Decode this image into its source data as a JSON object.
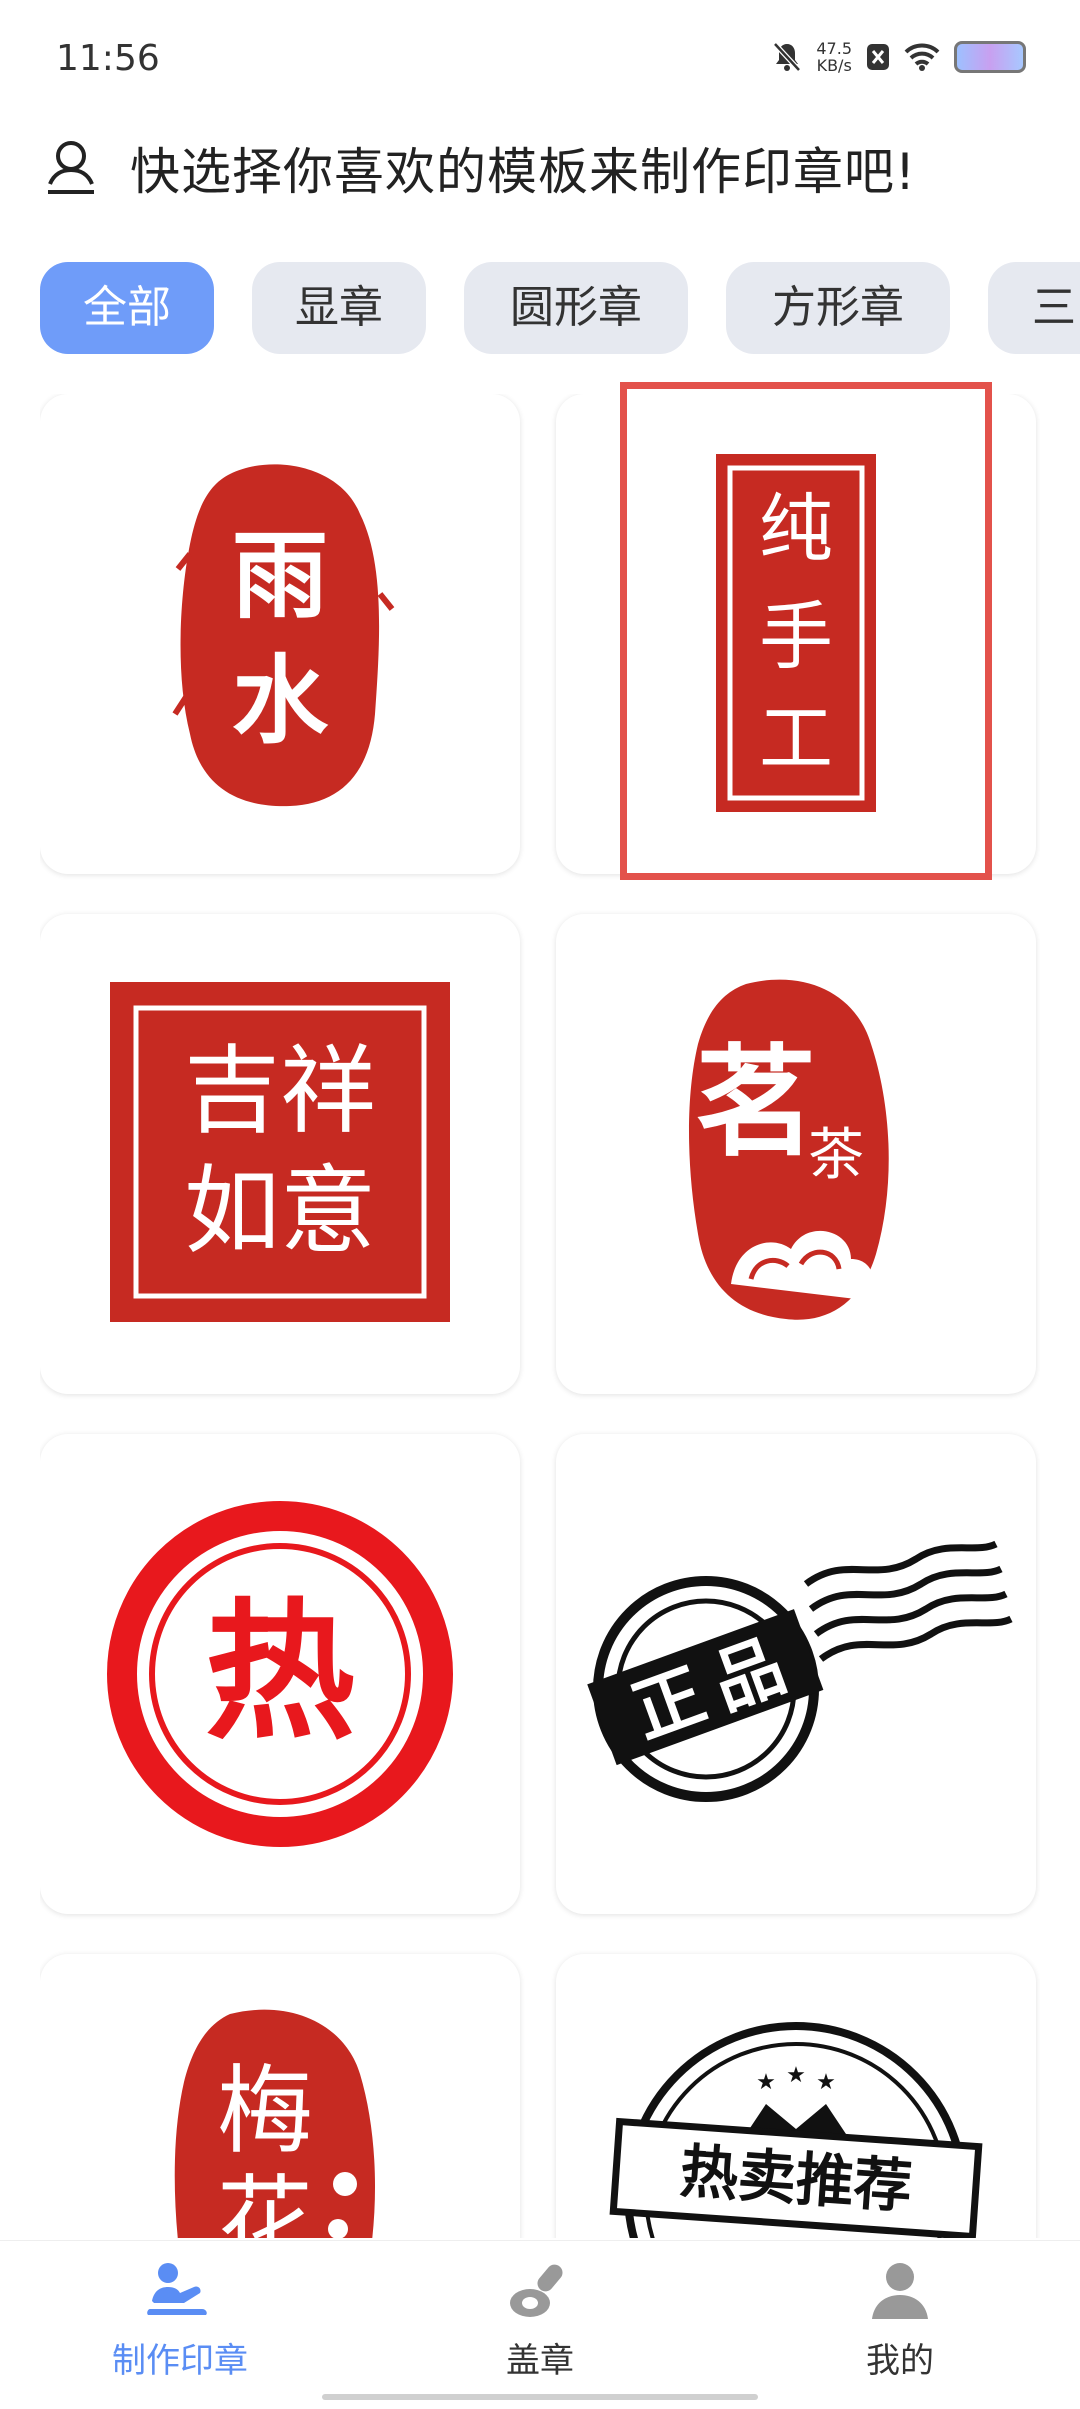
{
  "status": {
    "time": "11:56",
    "speed_value": "47.5",
    "speed_unit": "KB/s"
  },
  "header": {
    "title": "快选择你喜欢的模板来制作印章吧!"
  },
  "tabs": [
    {
      "label": "全部",
      "active": true
    },
    {
      "label": "显章",
      "active": false
    },
    {
      "label": "圆形章",
      "active": false
    },
    {
      "label": "方形章",
      "active": false
    },
    {
      "label": "三",
      "active": false
    }
  ],
  "templates": [
    {
      "line1": "雨",
      "line2": "水"
    },
    {
      "line1": "纯",
      "line2": "手",
      "line3": "工"
    },
    {
      "line1": "吉祥",
      "line2": "如意"
    },
    {
      "line1": "茗",
      "line2": "茶"
    },
    {
      "line1": "热"
    },
    {
      "line1": "正",
      "line2": "品"
    },
    {
      "line1": "梅",
      "line2": "花"
    },
    {
      "line1": "热卖推荐"
    }
  ],
  "nav": {
    "make": "制作印章",
    "stamp": "盖章",
    "mine": "我的"
  },
  "colors": {
    "accent": "#6f9cf9",
    "seal_red": "#c62a22",
    "highlight": "#e3524b"
  }
}
